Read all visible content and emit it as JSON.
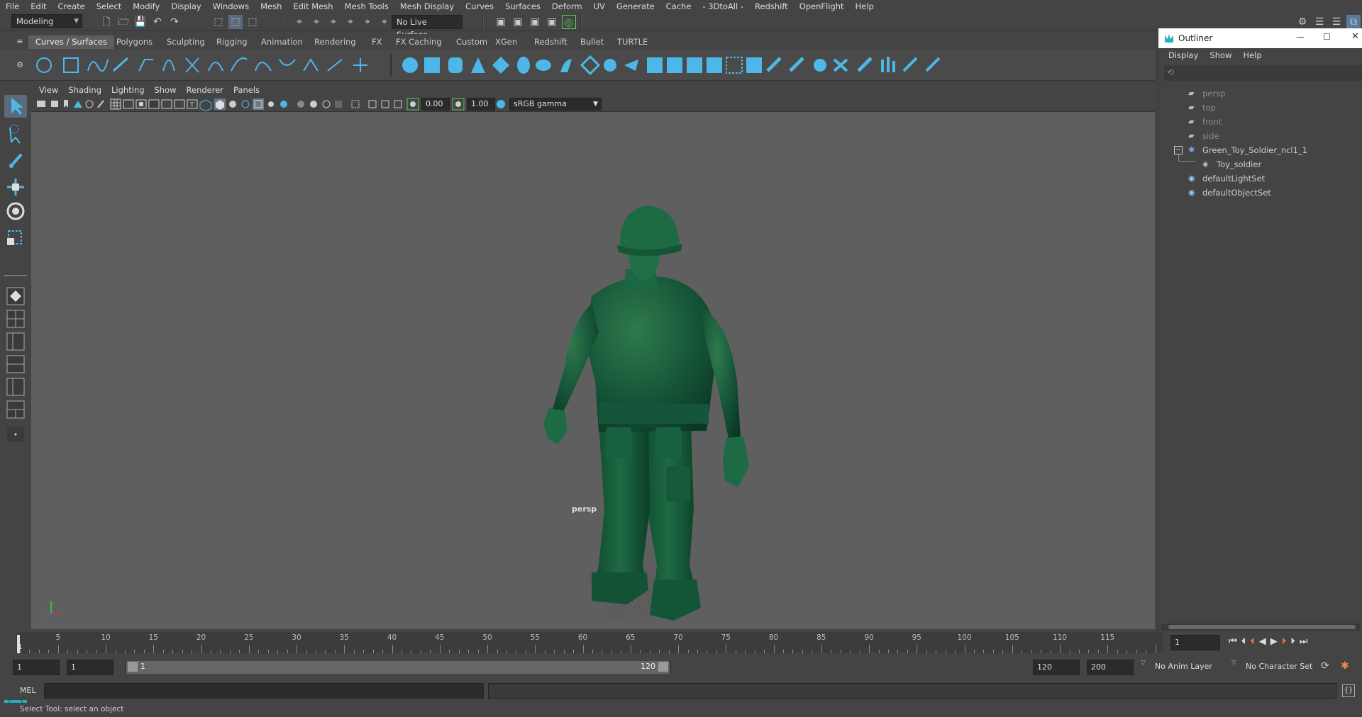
{
  "menubar": [
    "File",
    "Edit",
    "Create",
    "Select",
    "Modify",
    "Display",
    "Windows",
    "Mesh",
    "Edit Mesh",
    "Mesh Tools",
    "Mesh Display",
    "Curves",
    "Surfaces",
    "Deform",
    "UV",
    "Generate",
    "Cache",
    "- 3DtoAll -",
    "Redshift",
    "OpenFlight",
    "Help"
  ],
  "statusline": {
    "mode": "Modeling",
    "live_surface": "No Live Surface"
  },
  "shelf_tabs": [
    "Curves / Surfaces",
    "Polygons",
    "Sculpting",
    "Rigging",
    "Animation",
    "Rendering",
    "FX",
    "FX Caching",
    "Custom",
    "XGen",
    "Redshift",
    "Bullet",
    "TURTLE"
  ],
  "active_shelf_tab": "Curves / Surfaces",
  "viewport": {
    "menu": [
      "View",
      "Shading",
      "Lighting",
      "Show",
      "Renderer",
      "Panels"
    ],
    "exposure": "0.00",
    "gamma": "1.00",
    "color_space": "sRGB gamma",
    "camera_label": "persp"
  },
  "outliner": {
    "title": "Outliner",
    "menu": [
      "Display",
      "Show",
      "Help"
    ],
    "items": [
      {
        "label": "persp",
        "type": "camera",
        "dim": true
      },
      {
        "label": "top",
        "type": "camera",
        "dim": true
      },
      {
        "label": "front",
        "type": "camera",
        "dim": true
      },
      {
        "label": "side",
        "type": "camera",
        "dim": true
      },
      {
        "label": "Green_Toy_Soldier_ncl1_1",
        "type": "group",
        "dim": false
      },
      {
        "label": "Toy_soldier",
        "type": "mesh",
        "dim": false
      },
      {
        "label": "defaultLightSet",
        "type": "set",
        "dim": false
      },
      {
        "label": "defaultObjectSet",
        "type": "set",
        "dim": false
      }
    ]
  },
  "timeline": {
    "ticks": [
      "5",
      "10",
      "15",
      "20",
      "25",
      "30",
      "35",
      "40",
      "45",
      "50",
      "55",
      "60",
      "65",
      "70",
      "75",
      "80",
      "85",
      "90",
      "95",
      "100",
      "105",
      "110",
      "115"
    ],
    "current_frame_marker": "1",
    "current_frame_field": "1"
  },
  "range": {
    "start": "1",
    "playback_start": "1",
    "slider_start": "1",
    "slider_end": "120",
    "playback_end": "120",
    "end": "200",
    "anim_layer": "No Anim Layer",
    "character_set": "No Character Set"
  },
  "cmdline": {
    "lang": "MEL"
  },
  "helpline": {
    "text": "Select Tool: select an object"
  }
}
